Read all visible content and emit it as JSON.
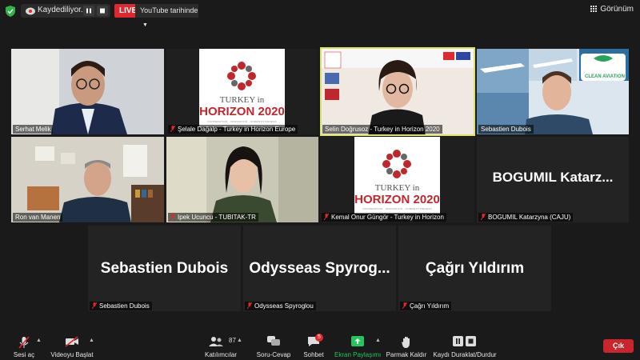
{
  "topbar": {
    "recording_label": "Kaydediliyor...",
    "live_label": "LIVE",
    "youtube_label": "YouTube tarihinde",
    "view_label": "Görünüm"
  },
  "participants": [
    {
      "name": "Serhat Melik",
      "muted": false
    },
    {
      "name": "Şelale Dağalp - Turkey in Horizon Europe",
      "muted": true
    },
    {
      "name": "Selin Doğrusoz - Turkey in Horizon 2020",
      "muted": false
    },
    {
      "name": "Sebastien Dubois",
      "muted": false
    },
    {
      "name": "Ron van Manen",
      "muted": false
    },
    {
      "name": "Ipek Ucuncu - TUBITAK-TR",
      "muted": true
    },
    {
      "name": "Kemal Onur Güngör - Turkey in Horizon",
      "muted": true
    },
    {
      "name": "BOGUMIL Katarzyna (CAJU)",
      "muted": true
    },
    {
      "name": "Sebastien Dubois",
      "muted": true
    },
    {
      "name": "Odysseas Spyroglou",
      "muted": true
    },
    {
      "name": "Çağrı Yıldırım",
      "muted": true
    }
  ],
  "big_names": {
    "bogumil": "BOGUMIL  Katarz...",
    "sebastien": "Sebastien Dubois",
    "odysseas": "Odysseas  Spyrog...",
    "cagri": "Çağrı Yıldırım"
  },
  "logo": {
    "line1": "TURKEY in",
    "line2": "HORIZON 2020",
    "tagline": "COOPERATION · INNOVATION · COMPETITIVENESS"
  },
  "slide": {
    "clean_aviation": "CLEAN AVIATION"
  },
  "toolbar": {
    "audio_label": "Sesi aç",
    "video_label": "Videoyu Başlat",
    "participants_label": "Katılımcılar",
    "participants_count": "87",
    "qa_label": "Soru-Cevap",
    "chat_label": "Sohbet",
    "chat_badge": "5",
    "share_label": "Ekran Paylaşımı",
    "raise_hand_label": "Parmak Kaldır",
    "pause_recording_label": "Kaydı Duraklat/Durdur",
    "exit_label": "Çık"
  },
  "colors": {
    "active_speaker_border": "#d9e36b",
    "live_red": "#e0282e",
    "share_green": "#22c55e",
    "exit_red": "#c9252c"
  }
}
